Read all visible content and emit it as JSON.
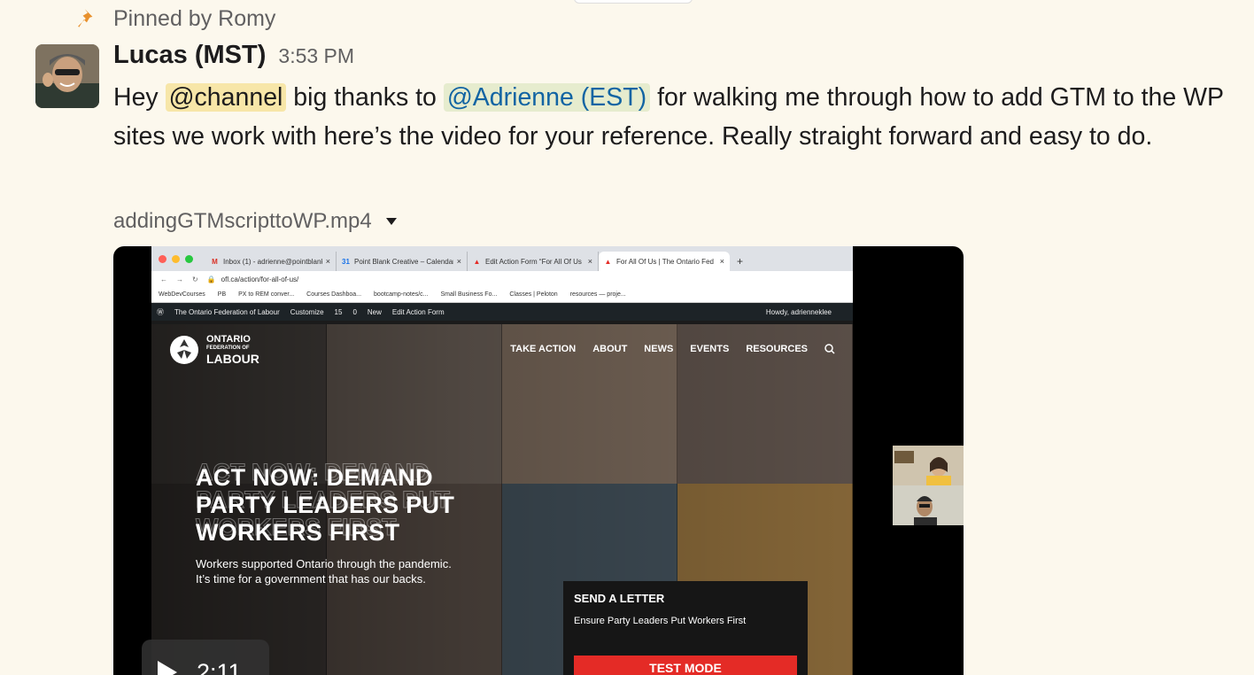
{
  "pinned": {
    "text": "Pinned by Romy",
    "icon": "pin-icon",
    "color": "#e8912d"
  },
  "message": {
    "author": "Lucas (MST)",
    "time": "3:53 PM",
    "text_1": "Hey ",
    "mention_channel": "@channel",
    "text_2": " big thanks to ",
    "mention_user": "@Adrienne (EST)",
    "text_3": " for walking me through how to add GTM to the WP sites we work with here’s the video for your reference. Really straight forward and easy to do."
  },
  "attachment": {
    "filename": "addingGTMscripttoWP.mp4",
    "duration": "2:11"
  },
  "video_frame": {
    "tabs": [
      {
        "icon": "M",
        "label": "Inbox (1) - adrienne@pointblank"
      },
      {
        "icon": "31",
        "label": "Point Blank Creative – Calendar"
      },
      {
        "icon": "▲",
        "label": "Edit Action Form “For All Of Us"
      },
      {
        "icon": "▲",
        "label": "For All Of Us | The Ontario Fed"
      }
    ],
    "new_tab": "+",
    "url": "ofl.ca/action/for-all-of-us/",
    "bookmarks": [
      "WebDevCourses",
      "PB",
      "PX to REM conver...",
      "Courses Dashboa...",
      "bootcamp-notes/c...",
      "Small Business Fo...",
      "Classes | Peloton",
      "resources — proje..."
    ],
    "wp_bar": {
      "site_name": "The Ontario Federation of Labour",
      "customize": "Customize",
      "updates": "15",
      "comments": "0",
      "new": "New",
      "edit": "Edit Action Form",
      "howdy": "Howdy, adrienneklee"
    },
    "site": {
      "logo_line1": "ONTARIO",
      "logo_line2": "FEDERATION OF",
      "logo_line3": "LABOUR",
      "nav": [
        "TAKE ACTION",
        "ABOUT",
        "NEWS",
        "EVENTS",
        "RESOURCES"
      ],
      "headline": "ACT NOW: DEMAND PARTY LEADERS PUT WORKERS FIRST",
      "subtext": "Workers supported Ontario through the pandemic. It’s time for a government that has our backs.",
      "letter_title": "SEND A LETTER",
      "letter_subtitle": "Ensure Party Leaders Put Workers First",
      "test_mode": "TEST MODE"
    }
  }
}
